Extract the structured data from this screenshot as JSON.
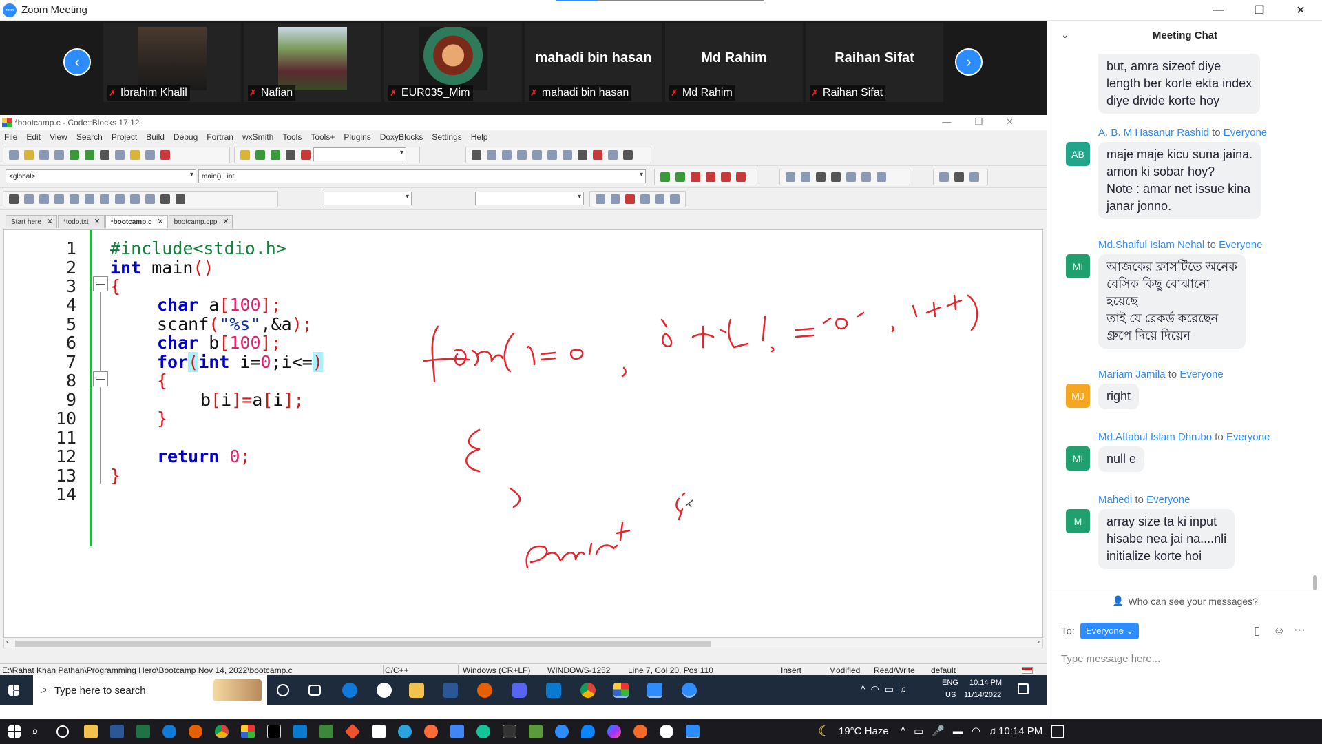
{
  "window": {
    "title": "Zoom Meeting",
    "logo_text": "zoom",
    "minimize": "—",
    "restore": "❐",
    "close": "✕"
  },
  "participants": [
    {
      "label": "Ibrahim Khalil",
      "big_name": ""
    },
    {
      "label": "Nafian",
      "big_name": ""
    },
    {
      "label": "EUR035_Mim",
      "big_name": ""
    },
    {
      "label": "mahadi bin hasan",
      "big_name": "mahadi bin hasan"
    },
    {
      "label": "Md Rahim",
      "big_name": "Md Rahim"
    },
    {
      "label": "Raihan Sifat",
      "big_name": "Raihan Sifat"
    }
  ],
  "codeblocks": {
    "title": "*bootcamp.c - Code::Blocks 17.12",
    "menu": [
      "File",
      "Edit",
      "View",
      "Search",
      "Project",
      "Build",
      "Debug",
      "Fortran",
      "wxSmith",
      "Tools",
      "Tools+",
      "Plugins",
      "DoxyBlocks",
      "Settings",
      "Help"
    ],
    "scope_combo": "<global>",
    "function_combo": "main() : int",
    "tabs": [
      "Start here",
      "*todo.txt",
      "*bootcamp.c",
      "bootcamp.cpp"
    ],
    "active_tab": 2,
    "line_numbers": [
      "1",
      "2",
      "3",
      "4",
      "5",
      "6",
      "7",
      "8",
      "9",
      "10",
      "11",
      "12",
      "13",
      "14"
    ],
    "code": {
      "l1": "#include<stdio.h>",
      "l2_kw": "int",
      "l2_rest": " main",
      "l2_paren": "()",
      "l3": "{",
      "l4_kw": "char",
      "l4_rest": " a",
      "l4_b1": "[",
      "l4_num": "100",
      "l4_b2": "];",
      "l5_fn": "scanf",
      "l5_p1": "(",
      "l5_str": "\"%s\"",
      "l5_rest": ",&a",
      "l5_p2": ");",
      "l6_kw": "char",
      "l6_rest": " b",
      "l6_b1": "[",
      "l6_num": "100",
      "l6_b2": "];",
      "l7_kw": "for",
      "l7_p1": "(",
      "l7_kw2": "int",
      "l7_rest": " i=",
      "l7_num": "0",
      "l7_rest2": ";i<=",
      "l7_p2": ")",
      "l8": "{",
      "l9_a": "b",
      "l9_b1": "[",
      "l9_i": "i",
      "l9_b2": "]=",
      "l9_c": "a",
      "l9_b3": "[",
      "l9_i2": "i",
      "l9_b4": "];",
      "l10": "}",
      "l12_kw": "return",
      "l12_num": " 0",
      "l12_end": ";",
      "l13": "}"
    },
    "status": {
      "path": "E:\\Rahat Khan Pathan\\Programming Hero\\Bootcamp Nov 14, 2022\\bootcamp.c",
      "language": "C/C++",
      "eol": "Windows (CR+LF)",
      "encoding": "WINDOWS-1252",
      "position": "Line 7, Col 20, Pos 110",
      "mode": "Insert",
      "modified": "Modified",
      "access": "Read/Write",
      "profile": "default"
    }
  },
  "remote_taskbar": {
    "search_placeholder": "Type here to search",
    "lang": "ENG",
    "region": "US",
    "time": "10:14 PM",
    "date": "11/14/2022"
  },
  "chat": {
    "header": "Meeting Chat",
    "messages": [
      {
        "sender": "",
        "to": "",
        "avatar": "",
        "avatar_color": "#2e9d70",
        "lines": [
          "but, amra sizeof diye",
          "length ber korle ekta index",
          "diye divide korte hoy"
        ]
      },
      {
        "sender": "A. B. M Hasanur Rashid",
        "to": "Everyone",
        "avatar": "AB",
        "avatar_color": "#22a58a",
        "lines": [
          "maje maje kicu suna jaina.",
          "amon ki sobar hoy?",
          "Note : amar net issue kina",
          "janar jonno."
        ]
      },
      {
        "sender": "Md.Shaiful Islam Nehal",
        "to": "Everyone",
        "avatar": "MI",
        "avatar_color": "#1fa06e",
        "lines": [
          "আজকের ক্লাসটিতে অনেক",
          "বেসিক কিছু বোঝানো",
          "হয়েছে",
          "তাই যে রেকর্ড করেছেন",
          "গ্রুপে দিয়ে দিয়েন"
        ]
      },
      {
        "sender": "Mariam Jamila",
        "to": "Everyone",
        "avatar": "MJ",
        "avatar_color": "#f5a623",
        "lines": [
          "right"
        ]
      },
      {
        "sender": "Md.Aftabul Islam Dhrubo",
        "to": "Everyone",
        "avatar": "MI",
        "avatar_color": "#1fa06e",
        "lines": [
          "null e"
        ]
      },
      {
        "sender": "Mahedi",
        "to": "Everyone",
        "avatar": "M",
        "avatar_color": "#1fa06e",
        "lines": [
          "array size ta ki input",
          "hisabe nea jai na....nli",
          "initialize korte hoi"
        ]
      }
    ],
    "to_word": "to",
    "privacy": "Who can see your messages?",
    "to_label": "To:",
    "recipient": "Everyone",
    "input_placeholder": "Type message here...",
    "more": "···"
  },
  "taskbar": {
    "weather": "19°C  Haze",
    "time": "10:14 PM"
  },
  "colors": {
    "zoom_blue": "#2d8cff",
    "ink_red": "#e8242c",
    "change_bar_green": "#1fb940"
  }
}
